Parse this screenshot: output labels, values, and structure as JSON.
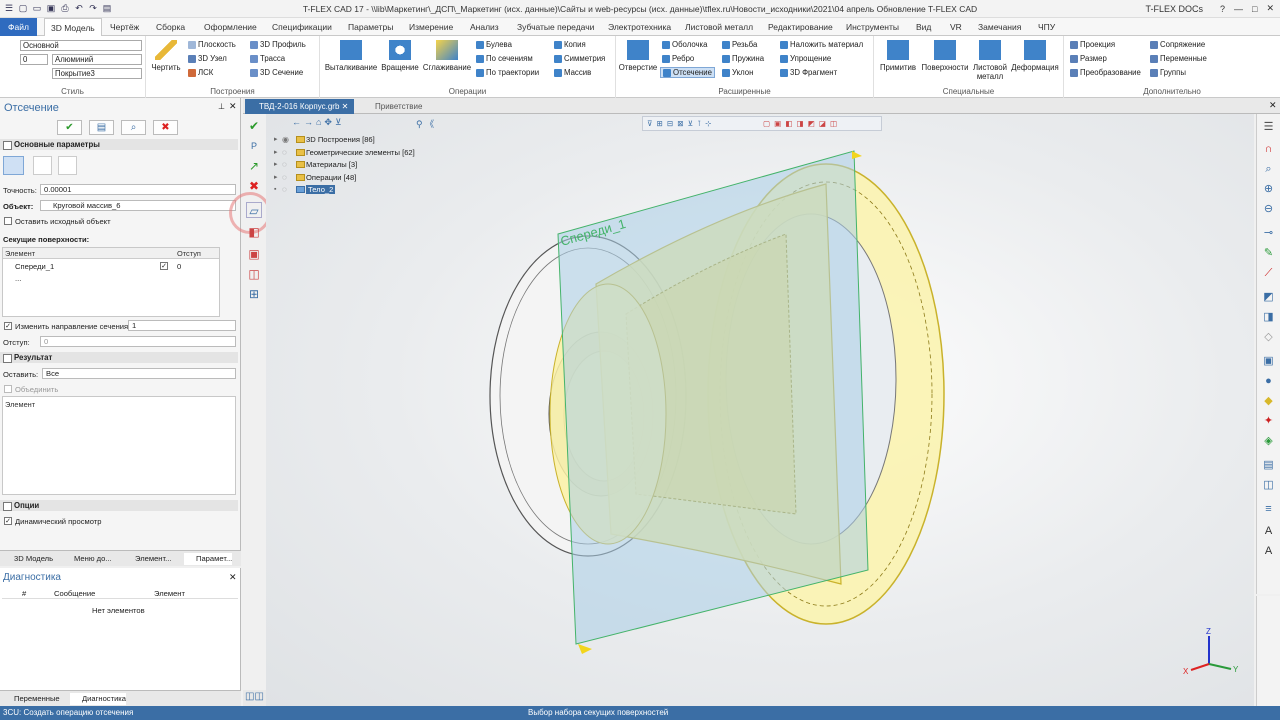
{
  "window": {
    "title": "T-FLEX CAD 17 - \\\\lib\\Маркетинг\\_ДСП\\_Маркетинг (исх. данные)\\Сайты и web-ресурсы (исх. данные)\\tflex.ru\\Новости_исходники\\2021\\04 апрель Обновление T-FLEX CAD",
    "docs_label": "T-FLEX DOCs"
  },
  "tabs": [
    "Файл",
    "3D Модель",
    "Чертёж",
    "Сборка",
    "Оформление",
    "Спецификации",
    "Параметры",
    "Измерение",
    "Анализ",
    "Зубчатые передачи",
    "Электротехника",
    "Листовой металл",
    "Редактирование",
    "Инструменты",
    "Вид",
    "VR",
    "Замечания",
    "ЧПУ"
  ],
  "ribbon": {
    "style": {
      "label": "Стиль",
      "combo1": "Основной",
      "combo2": "0",
      "combo3": "Алюминий",
      "combo4": "Покрытие3"
    },
    "build": {
      "label": "Построения",
      "draw": "Чертить",
      "plane": "Плоскость",
      "node3d": "3D Узел",
      "lsk": "ЛСК",
      "profile3d": "3D Профиль",
      "trace": "Трасса",
      "section3d": "3D Сечение"
    },
    "ops": {
      "label": "Операции",
      "extrude": "Выталкивание",
      "rotate": "Вращение",
      "smooth": "Сглаживание",
      "boolean": "Булева",
      "by_sections": "По сечениям",
      "by_path": "По траектории",
      "copy": "Копия",
      "symmetry": "Симметрия",
      "arrays": "Массив"
    },
    "ext": {
      "label": "Расширенные",
      "hole": "Отверстие",
      "shell": "Оболочка",
      "rib": "Ребро",
      "cut": "Отсечение",
      "thread": "Резьба",
      "spring": "Пружина",
      "slope": "Уклон",
      "material": "Наложить материал",
      "simplify": "Упрощение",
      "fragment": "3D Фрагмент"
    },
    "special": {
      "label": "Специальные",
      "primitives": "Примитив",
      "surfaces": "Поверхности",
      "sheet": "Листовой металл",
      "deform": "Деформация"
    },
    "extra": {
      "label": "Дополнительно",
      "projection": "Проекция",
      "size": "Размер",
      "transform": "Преобразование",
      "conjugation": "Сопряжение",
      "variables": "Переменные",
      "groups": "Группы"
    }
  },
  "left_panel": {
    "title": "Отсечение",
    "main_params": "Основные параметры",
    "precision_label": "Точность:",
    "precision": "0.00001",
    "object_label": "Объект:",
    "object": "Круговой массив_6",
    "keep_source": "Оставить исходный объект",
    "cut_surfaces": "Секущие поверхности:",
    "col_element": "Элемент",
    "col_offset": "Отступ",
    "rows": [
      {
        "name": "Спереди_1",
        "offset": "0",
        "checked": "✓"
      },
      {
        "name": "...",
        "offset": "",
        "checked": ""
      }
    ],
    "change_dir": "Изменить направление сечения:",
    "change_dir_val": "1",
    "offset_label": "Отступ:",
    "offset_val": "0",
    "result": "Результат",
    "leave_label": "Оставить:",
    "leave_val": "Все",
    "combine": "Объединить",
    "result_element": "Элемент",
    "options": "Опции",
    "dyn_view": "Динамический просмотр",
    "bottom_tabs": [
      "3D Модель",
      "Меню до...",
      "Элемент...",
      "Парамет..."
    ]
  },
  "diagnostics": {
    "title": "Диагностика",
    "col_num": "#",
    "col_msg": "Сообщение",
    "col_elem": "Элемент",
    "empty": "Нет элементов",
    "bottom_tabs": [
      "Переменные",
      "Диагностика"
    ]
  },
  "doc_tabs": [
    "ТВД-2-016 Корпус.grb",
    "Приветствие"
  ],
  "tree": [
    {
      "label": "3D Построения [86]"
    },
    {
      "label": "Геометрические элементы [62]"
    },
    {
      "label": "Материалы [3]"
    },
    {
      "label": "Операции [48]"
    },
    {
      "label": "Тело_2"
    }
  ],
  "scene": {
    "plane_label": "Спереди_1",
    "axes": {
      "x": "X",
      "y": "Y",
      "z": "Z"
    }
  },
  "status": {
    "left": "3CU: Создать операцию отсечения",
    "center": "Выбор набора секущих поверхностей"
  },
  "colors": {
    "accent": "#3b6ea5",
    "file_tab": "#2f6bbf",
    "body": "#f5ea8a",
    "plane": "#a9cde6"
  }
}
